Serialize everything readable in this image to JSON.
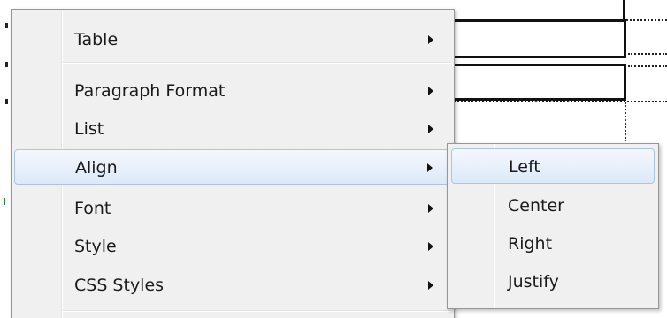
{
  "context_menu": {
    "items": [
      {
        "label": "Table",
        "has_submenu": true,
        "highlighted": false
      },
      {
        "label": "Paragraph Format",
        "has_submenu": true,
        "highlighted": false
      },
      {
        "label": "List",
        "has_submenu": true,
        "highlighted": false
      },
      {
        "label": "Align",
        "has_submenu": true,
        "highlighted": true
      },
      {
        "label": "Font",
        "has_submenu": true,
        "highlighted": false
      },
      {
        "label": "Style",
        "has_submenu": true,
        "highlighted": false
      },
      {
        "label": "CSS Styles",
        "has_submenu": true,
        "highlighted": false
      }
    ]
  },
  "align_submenu": {
    "items": [
      {
        "label": "Left",
        "highlighted": true
      },
      {
        "label": "Center",
        "highlighted": false
      },
      {
        "label": "Right",
        "highlighted": false
      },
      {
        "label": "Justify",
        "highlighted": false
      }
    ]
  },
  "colors": {
    "menu_background": "#f0f0f0",
    "highlight_border": "#a9c6ea",
    "highlight_fill": "#dde9f8"
  }
}
